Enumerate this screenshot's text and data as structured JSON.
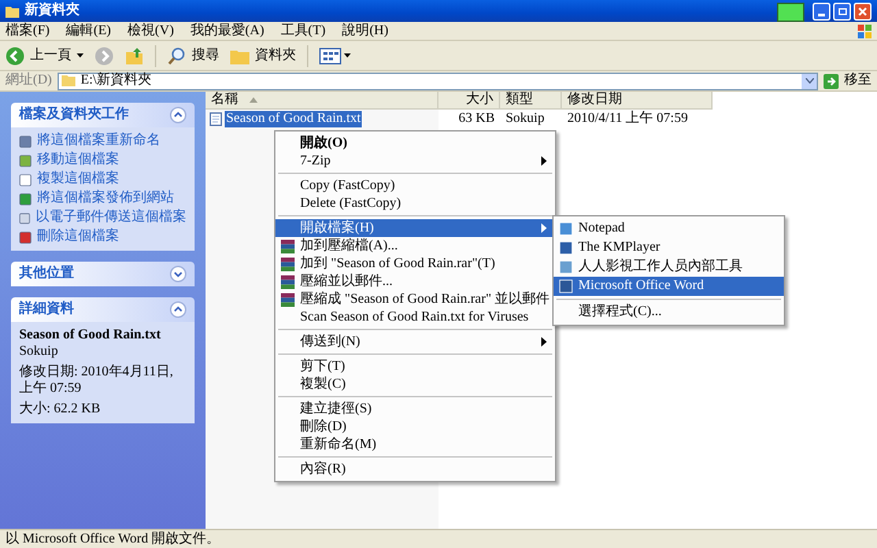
{
  "window": {
    "title": "新資料夾"
  },
  "menu_bar": [
    "檔案(F)",
    "編輯(E)",
    "檢視(V)",
    "我的最愛(A)",
    "工具(T)",
    "說明(H)"
  ],
  "toolbar": {
    "back": "上一頁",
    "search": "搜尋",
    "folders": "資料夾"
  },
  "address_bar": {
    "label": "網址(D)",
    "value": "E:\\新資料夾",
    "go": "移至"
  },
  "task_panels": [
    {
      "title": "檔案及資料夾工作",
      "expanded": true,
      "items": [
        "將這個檔案重新命名",
        "移動這個檔案",
        "複製這個檔案",
        "將這個檔案發佈到網站",
        "以電子郵件傳送這個檔案",
        "刪除這個檔案"
      ]
    },
    {
      "title": "其他位置",
      "expanded": false
    },
    {
      "title": "詳細資料",
      "expanded": true,
      "details": {
        "name": "Season of Good Rain.txt",
        "type": "Sokuip",
        "modified": "修改日期: 2010年4月11日, 上午 07:59",
        "size": "大小: 62.2 KB"
      }
    }
  ],
  "columns": [
    {
      "label": "名稱",
      "sorted": true
    },
    {
      "label": "大小",
      "sorted": false
    },
    {
      "label": "類型",
      "sorted": false
    },
    {
      "label": "修改日期",
      "sorted": false
    }
  ],
  "files": [
    {
      "name": "Season of Good Rain.txt",
      "size": "63 KB",
      "type": "Sokuip",
      "modified": "2010/4/11 上午 07:59",
      "selected": true
    }
  ],
  "context_menu": [
    {
      "kind": "item",
      "label": "開啟(O)",
      "default": true,
      "submenu": false,
      "selected": false
    },
    {
      "kind": "item",
      "label": "7-Zip",
      "default": false,
      "submenu": true,
      "selected": false
    },
    {
      "kind": "separator"
    },
    {
      "kind": "item",
      "label": "Copy (FastCopy)",
      "default": false,
      "submenu": false,
      "selected": false
    },
    {
      "kind": "item",
      "label": "Delete (FastCopy)",
      "default": false,
      "submenu": false,
      "selected": false
    },
    {
      "kind": "separator"
    },
    {
      "kind": "item",
      "label": "開啟檔案(H)",
      "default": false,
      "submenu": true,
      "selected": true
    },
    {
      "kind": "archive",
      "label": "加到壓縮檔(A)...",
      "default": false,
      "submenu": false,
      "selected": false
    },
    {
      "kind": "archive",
      "label": "加到 \"Season of Good Rain.rar\"(T)",
      "default": false,
      "submenu": false,
      "selected": false
    },
    {
      "kind": "archive",
      "label": "壓縮並以郵件...",
      "default": false,
      "submenu": false,
      "selected": false
    },
    {
      "kind": "archive",
      "label": "壓縮成 \"Season of Good Rain.rar\" 並以郵件",
      "default": false,
      "submenu": false,
      "selected": false
    },
    {
      "kind": "item",
      "label": "Scan Season of Good Rain.txt for Viruses",
      "default": false,
      "submenu": false,
      "selected": false
    },
    {
      "kind": "separator"
    },
    {
      "kind": "item",
      "label": "傳送到(N)",
      "default": false,
      "submenu": true,
      "selected": false
    },
    {
      "kind": "separator"
    },
    {
      "kind": "item",
      "label": "剪下(T)",
      "default": false,
      "submenu": false,
      "selected": false
    },
    {
      "kind": "item",
      "label": "複製(C)",
      "default": false,
      "submenu": false,
      "selected": false
    },
    {
      "kind": "separator"
    },
    {
      "kind": "item",
      "label": "建立捷徑(S)",
      "default": false,
      "submenu": false,
      "selected": false
    },
    {
      "kind": "item",
      "label": "刪除(D)",
      "default": false,
      "submenu": false,
      "selected": false
    },
    {
      "kind": "item",
      "label": "重新命名(M)",
      "default": false,
      "submenu": false,
      "selected": false
    },
    {
      "kind": "separator"
    },
    {
      "kind": "item",
      "label": "內容(R)",
      "default": false,
      "submenu": false,
      "selected": false
    }
  ],
  "open_with_menu": [
    {
      "kind": "app",
      "label": "Notepad",
      "selected": false
    },
    {
      "kind": "app",
      "label": "The KMPlayer",
      "selected": false
    },
    {
      "kind": "app",
      "label": "人人影視工作人员內部工具",
      "selected": false
    },
    {
      "kind": "app",
      "label": "Microsoft Office Word",
      "selected": true
    },
    {
      "kind": "separator"
    },
    {
      "kind": "item",
      "label": "選擇程式(C)...",
      "selected": false
    }
  ],
  "status_bar": {
    "text": "以 Microsoft Office Word 開啟文件。"
  }
}
